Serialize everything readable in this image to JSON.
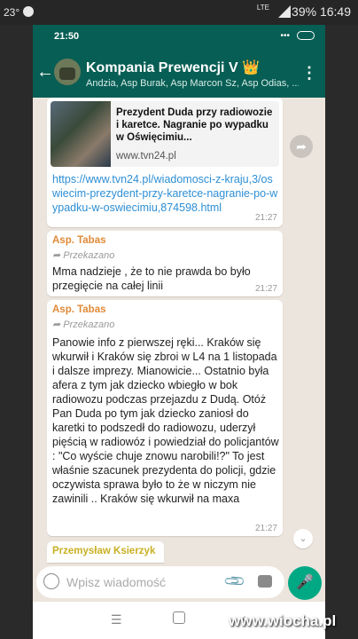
{
  "outer_status": {
    "temp": "23°",
    "lte": "LTE",
    "battery": "39%",
    "time": "16:49"
  },
  "phone_status": {
    "time": "21:50"
  },
  "header": {
    "title": "Kompania Prewencji V 👑",
    "members": "Andzia, Asp Burak, Asp Marcon Sz, Asp Odias, ..."
  },
  "messages": [
    {
      "preview_title": "Prezydent Duda przy radiowozie i karetce. Nagranie po wypadku w Oświęcimiu...",
      "preview_site": "www.tvn24.pl",
      "link": "https://www.tvn24.pl/wiadomosci-z-kraju,3/oswiecim-prezydent-przy-karetce-nagranie-po-wypadku-w-oswiecimiu,874598.html",
      "time": "21:27"
    },
    {
      "sender": "Asp. Tabas",
      "forwarded": "Przekazano",
      "text": "Mma nadzieje , że to nie prawda bo było przegięcie na całej linii",
      "time": "21:27"
    },
    {
      "sender": "Asp. Tabas",
      "forwarded": "Przekazano",
      "text": "Panowie info z pierwszej ręki... Kraków się wkurwił i Kraków się zbroi w L4 na 1 listopada i dalsze imprezy. Mianowicie... Ostatnio była afera z tym jak dziecko wbiegło w bok radiowozu podczas przejazdu z Dudą. Otóż Pan Duda po tym jak dziecko zaniosł do karetki to podszedł do radiowozu, uderzył pięścią w radiowóz i powiedział do policjantów : \"Co wyście chuje znowu narobili!?\" To jest właśnie szacunek prezydenta do policji, gdzie oczywista sprawa było to że w niczym nie zawinili .. Kraków się wkurwił na maxa",
      "time": "21:27"
    },
    {
      "sender": "Przemysław Ksierzyk"
    }
  ],
  "input": {
    "placeholder": "Wpisz wiadomość"
  },
  "watermark": "www.wiocha.pl",
  "colors": {
    "header": "#075E54",
    "chat_bg": "#ECE5DD",
    "link": "#2d8fd5",
    "send": "#00a884"
  }
}
